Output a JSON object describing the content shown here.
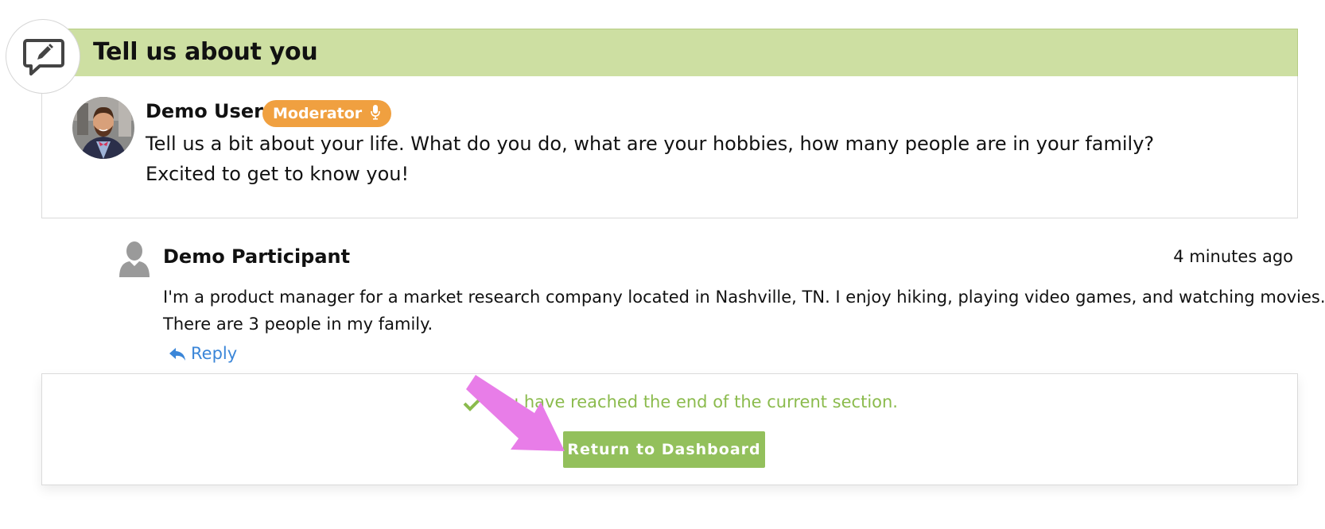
{
  "section": {
    "title": "Tell us about you",
    "header_icon": "chat-edit-icon"
  },
  "moderator_post": {
    "author": "Demo User",
    "badge": "Moderator",
    "badge_icon": "microphone-icon",
    "lines": [
      "Tell us a bit about your life. What do you do, what are your hobbies, how many people are in your family?",
      "Excited to get to know you!"
    ]
  },
  "reply": {
    "author": "Demo Participant",
    "timestamp": "4 minutes ago",
    "lines": [
      "I'm a product manager for a market research company located in Nashville, TN. I enjoy hiking, playing video games, and watching movies.",
      "There are 3 people in my family."
    ],
    "reply_label": "Reply"
  },
  "end_section": {
    "message": "You have reached the end of the current section.",
    "button_label": "Return to Dashboard"
  },
  "colors": {
    "header_bg": "#cddfa2",
    "moderator_badge": "#f0a040",
    "accent_green": "#93c05c",
    "link_blue": "#3b86d8",
    "annotation_arrow": "#e87de8"
  }
}
